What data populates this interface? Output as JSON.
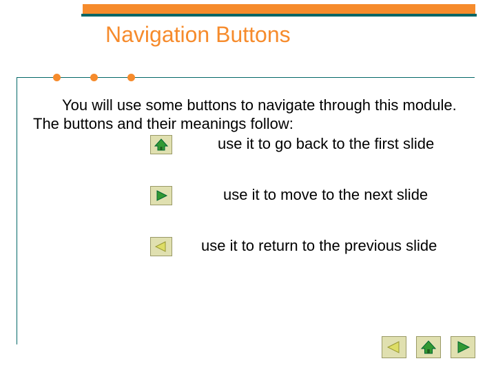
{
  "title": "Navigation Buttons",
  "intro": {
    "line1_prefix": "",
    "text": "You will use some buttons to navigate through this module. The buttons and their meanings follow:"
  },
  "rows": {
    "home": "use it to go back to the first slide",
    "next": "use it to move to the next slide",
    "prev": "use it to return to the previous slide"
  },
  "icons": {
    "home": "home-icon",
    "next": "play-right-icon",
    "prev": "play-left-icon"
  },
  "colors": {
    "accent": "#f68b2c",
    "teal": "#006666",
    "icon_green": "#339933",
    "icon_outline": "#006633",
    "btn_bg": "#e0e0b0"
  }
}
